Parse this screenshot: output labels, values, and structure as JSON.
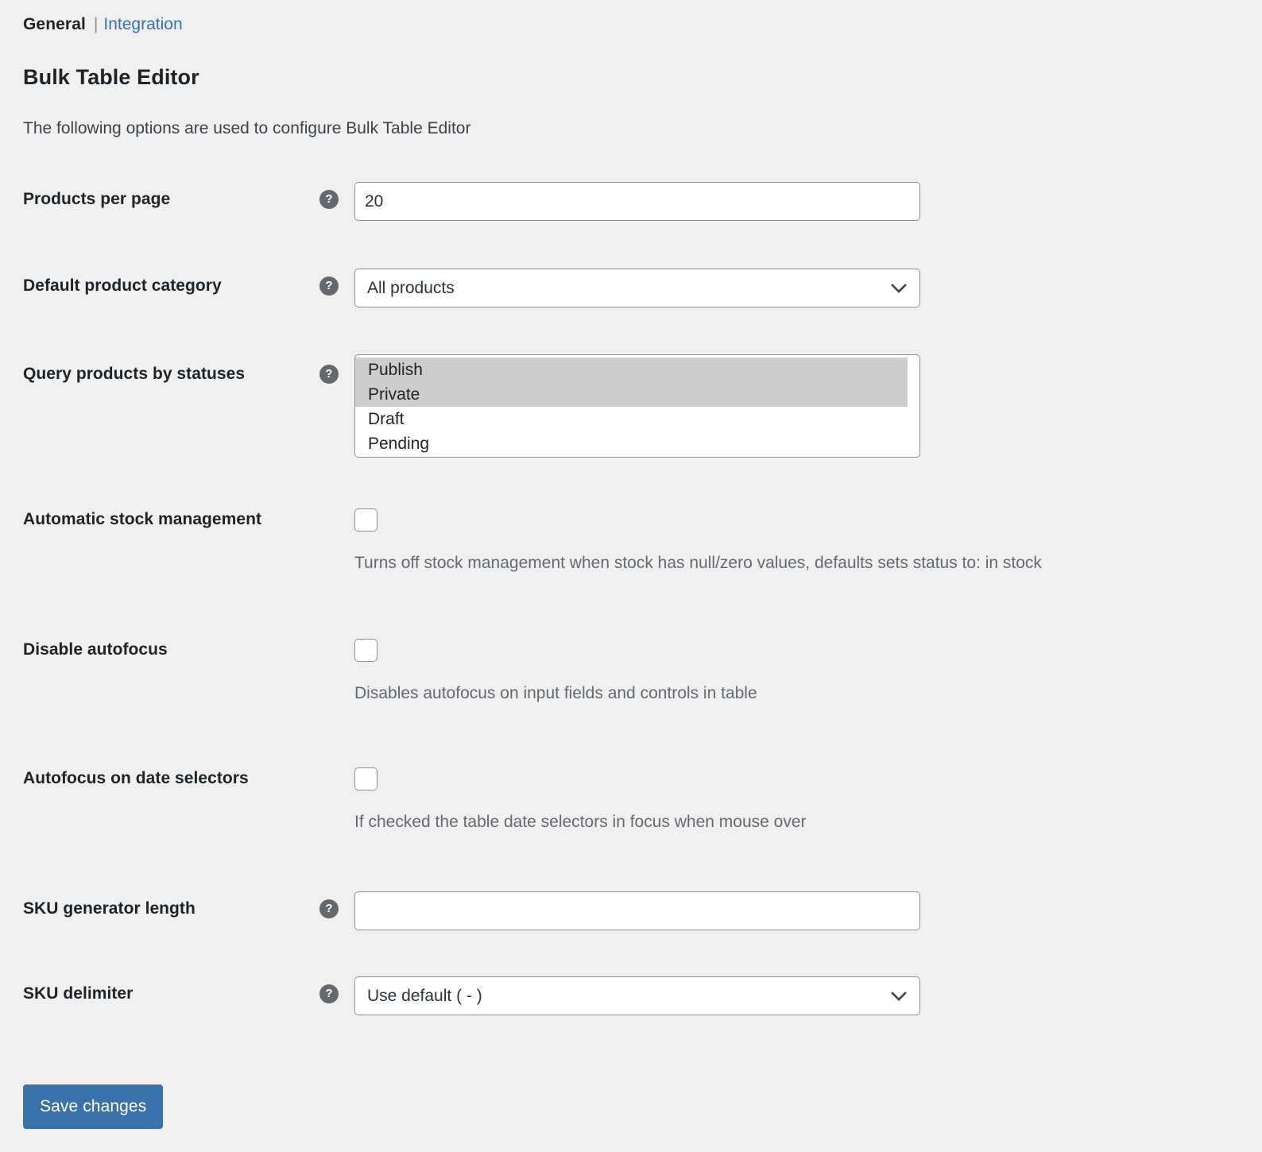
{
  "nav": {
    "current": "General",
    "separator": "|",
    "link": "Integration"
  },
  "header": {
    "title": "Bulk Table Editor",
    "description": "The following options are used to configure Bulk Table Editor"
  },
  "help_glyph": "?",
  "fields": {
    "products_per_page": {
      "label": "Products per page",
      "value": "20",
      "placeholder": ""
    },
    "default_product_category": {
      "label": "Default product category",
      "value": "All products",
      "options": [
        "All products"
      ]
    },
    "query_products_by_statuses": {
      "label": "Query products by statuses",
      "options": [
        {
          "label": "Publish",
          "selected": true
        },
        {
          "label": "Private",
          "selected": true
        },
        {
          "label": "Draft",
          "selected": false
        },
        {
          "label": "Pending",
          "selected": false
        }
      ]
    },
    "automatic_stock_management": {
      "label": "Automatic stock management",
      "checked": false,
      "description": "Turns off stock management when stock has null/zero values, defaults sets status to: in stock"
    },
    "disable_autofocus": {
      "label": "Disable autofocus",
      "checked": false,
      "description": "Disables autofocus on input fields and controls in table"
    },
    "autofocus_on_date_selectors": {
      "label": "Autofocus on date selectors",
      "checked": false,
      "description": "If checked the table date selectors in focus when mouse over"
    },
    "sku_generator_length": {
      "label": "SKU generator length",
      "value": "",
      "placeholder": ""
    },
    "sku_delimiter": {
      "label": "SKU delimiter",
      "value": "Use default ( - )",
      "options": [
        "Use default ( - )"
      ]
    }
  },
  "actions": {
    "save": "Save changes"
  },
  "colors": {
    "background": "#f0f0f1",
    "link": "#3a6fb0",
    "primary_button": "#3a72ab",
    "border": "#8c8f94",
    "selected_option": "#cdcdcd",
    "muted_text": "#646970"
  }
}
